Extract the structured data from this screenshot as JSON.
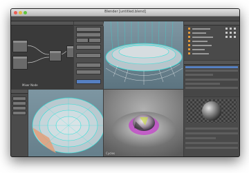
{
  "window": {
    "title": "Blender [untitled.blend]"
  },
  "panes": {
    "node_editor": {
      "label": "Mixer Node"
    },
    "preview": {
      "caption": "Cycles"
    }
  },
  "colors": {
    "viewport_bg": "#6e8a9a",
    "wire": "#2fe0d8",
    "selection": "#5680c2",
    "render_bg": "#8d8d8d"
  }
}
